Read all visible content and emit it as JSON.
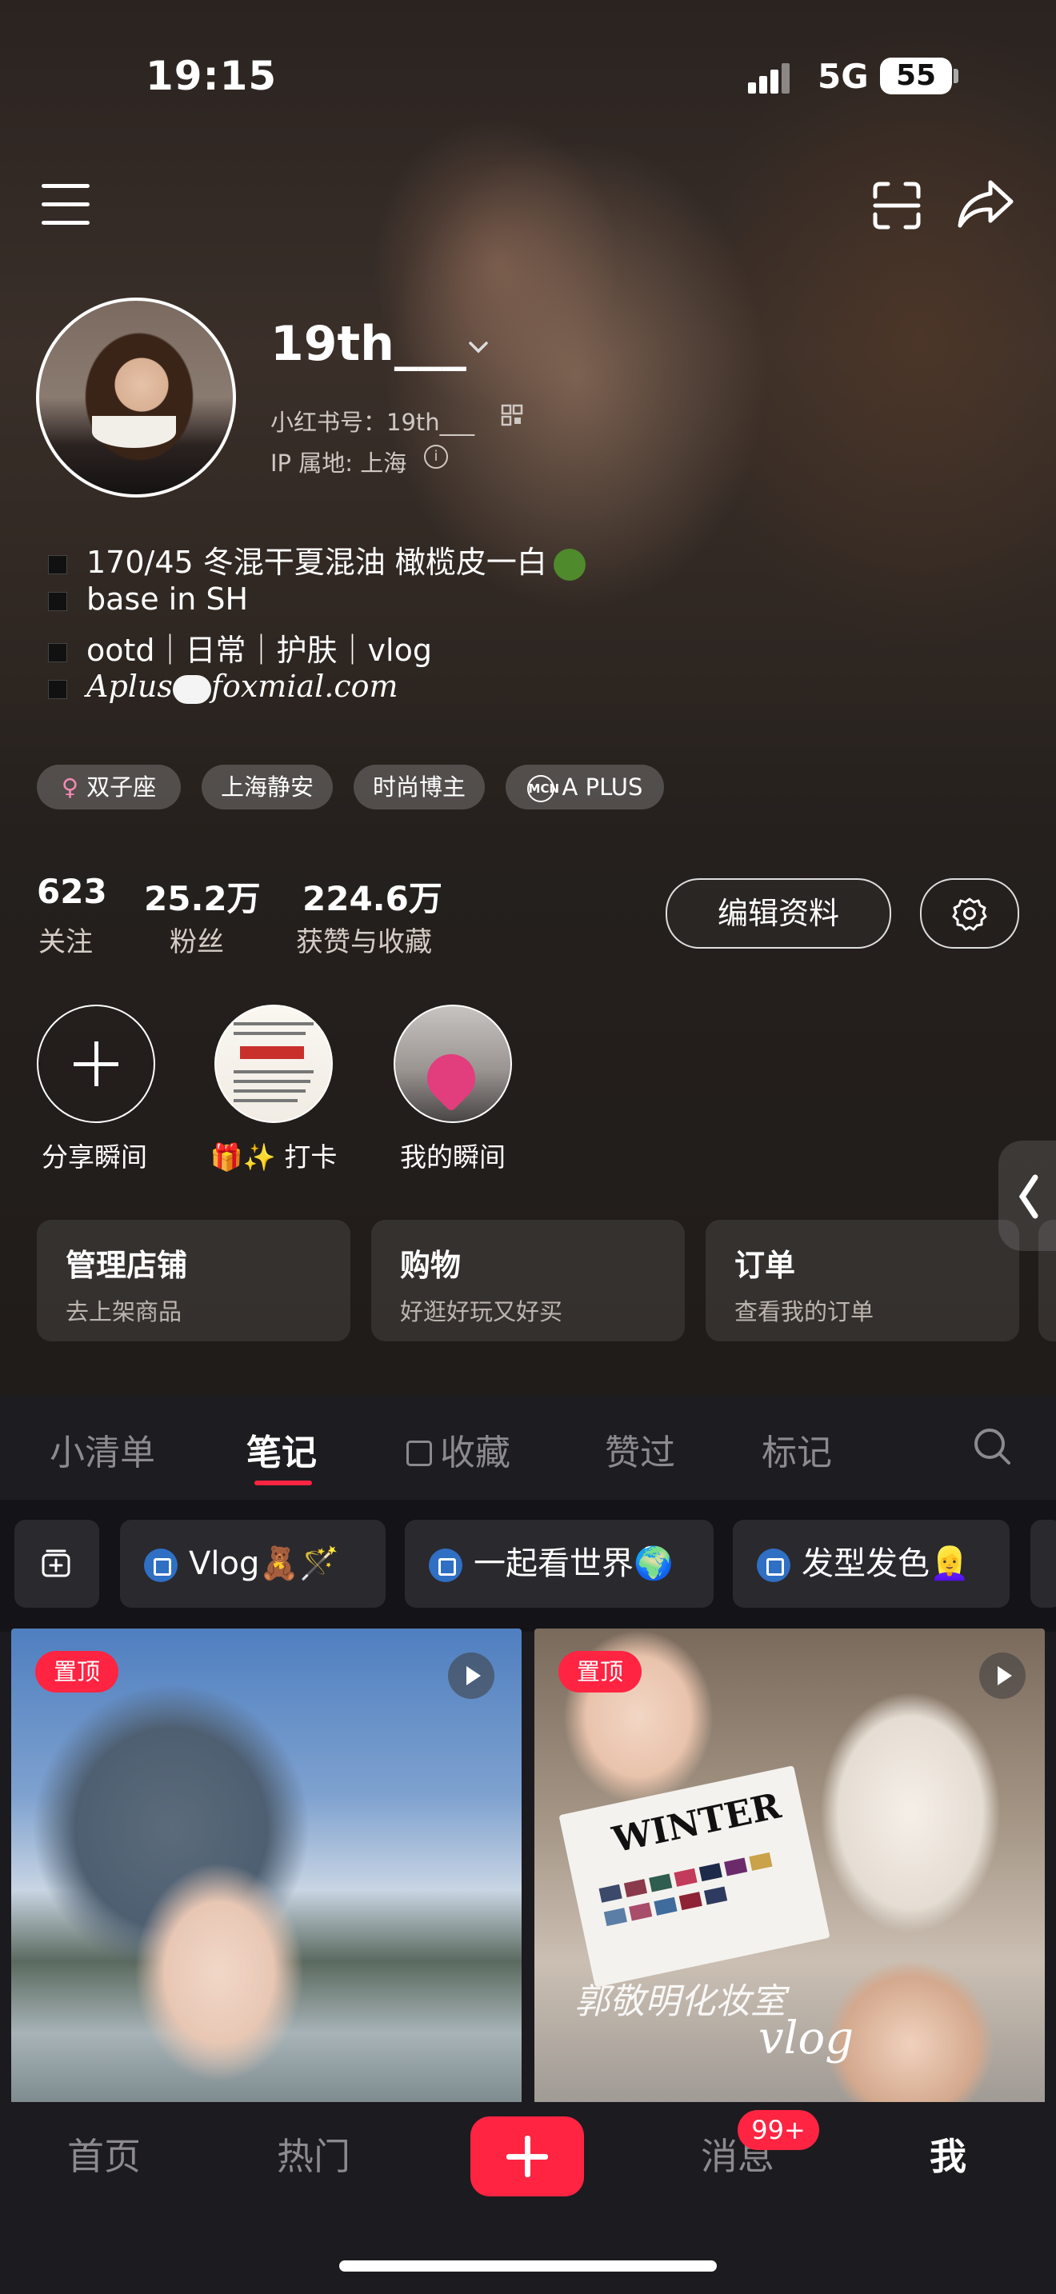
{
  "status_bar": {
    "time": "19:15",
    "network": "5G",
    "battery": "55"
  },
  "profile": {
    "username": "19th___",
    "xhs_id": "小红书号：19th___",
    "ip_location": "IP 属地: 上海",
    "bio": [
      "170/45 冬混干夏混油 橄榄皮一白",
      "base in SH",
      "ootd｜日常｜护肤｜vlog",
      "Aplus",
      "foxmial.com"
    ],
    "tags": [
      "双子座",
      "上海静安",
      "时尚博主",
      "A PLUS"
    ],
    "stats": [
      {
        "value": "623",
        "label": "关注"
      },
      {
        "value": "25.2万",
        "label": "粉丝"
      },
      {
        "value": "224.6万",
        "label": "获赞与收藏"
      }
    ],
    "edit_button": "编辑资料"
  },
  "moments": [
    {
      "label": "分享瞬间"
    },
    {
      "label": "🎁✨ 打卡"
    },
    {
      "label": "我的瞬间"
    }
  ],
  "shop_cards": [
    {
      "title": "管理店铺",
      "subtitle": "去上架商品"
    },
    {
      "title": "购物",
      "subtitle": "好逛好玩又好买"
    },
    {
      "title": "订单",
      "subtitle": "查看我的订单"
    }
  ],
  "tabs": [
    "小清单",
    "笔记",
    "收藏",
    "赞过",
    "标记"
  ],
  "active_tab": "笔记",
  "collections": [
    "Vlog🧸🪄",
    "一起看世界🌍",
    "发型发色👱‍♀️"
  ],
  "posts": [
    {
      "pinned_label": "置顶",
      "is_video": true
    },
    {
      "pinned_label": "置顶",
      "is_video": true,
      "overlay_text": "郭敬明化妆室",
      "overlay_script": "vlog",
      "card_title": "WINTER"
    }
  ],
  "bottom_nav": [
    "首页",
    "热门",
    "消息",
    "我"
  ],
  "message_badge": "99+",
  "colors": {
    "accent": "#ff2442",
    "background": "#1b1a1f"
  }
}
